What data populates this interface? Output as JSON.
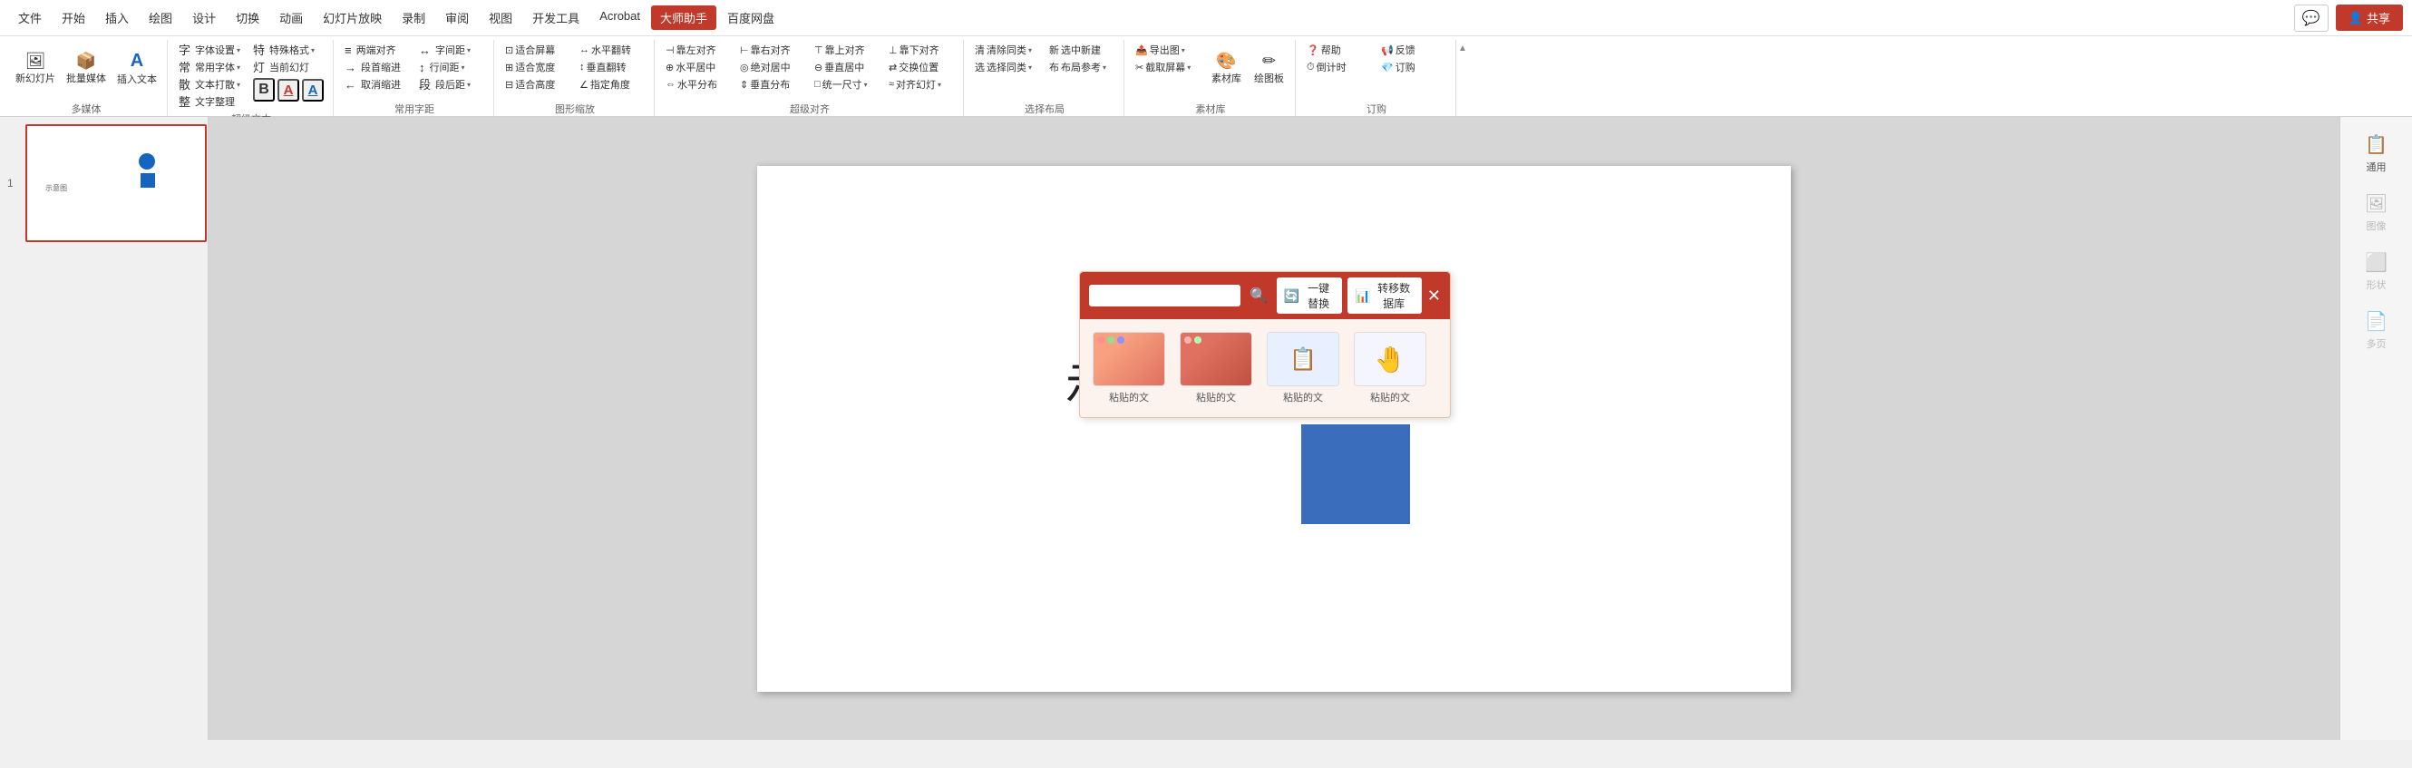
{
  "titlebar": {
    "menus": [
      "文件",
      "开始",
      "插入",
      "绘图",
      "设计",
      "切换",
      "动画",
      "幻灯片放映",
      "录制",
      "审阅",
      "视图",
      "开发工具",
      "Acrobat",
      "大师助手",
      "百度网盘"
    ],
    "active_menu": "大师助手",
    "chat_icon": "💬",
    "share_label": "共享"
  },
  "ribbon": {
    "groups": [
      {
        "label": "多媒体",
        "buttons": [
          {
            "id": "new-slide",
            "icon": "🖼",
            "label": "新幻灯片",
            "size": "large"
          },
          {
            "id": "batch-media",
            "icon": "📦",
            "label": "批量媒体",
            "size": "large"
          },
          {
            "id": "insert-text",
            "icon": "A",
            "label": "插入文本",
            "size": "large"
          }
        ]
      },
      {
        "label": "超级文本",
        "buttons": [
          {
            "id": "font-setting",
            "icon": "字",
            "label": "字体设置"
          },
          {
            "id": "common-font",
            "icon": "常",
            "label": "常用字体"
          },
          {
            "id": "text-scatter",
            "icon": "散",
            "label": "文本打散"
          },
          {
            "id": "text-arrange",
            "icon": "整",
            "label": "文字整理"
          },
          {
            "id": "special-format",
            "icon": "特",
            "label": "特殊格式"
          },
          {
            "id": "current-ppt",
            "icon": "灯",
            "label": "当前幻灯"
          },
          {
            "id": "bold-btn",
            "icon": "B",
            "label": ""
          },
          {
            "id": "color-red",
            "icon": "A",
            "label": ""
          },
          {
            "id": "color-blue",
            "icon": "A",
            "label": ""
          }
        ]
      },
      {
        "label": "常用字距",
        "buttons": [
          {
            "id": "justify",
            "icon": "≡",
            "label": "两端对齐"
          },
          {
            "id": "indent-increase",
            "icon": "→",
            "label": "段首缩进"
          },
          {
            "id": "indent-decrease",
            "icon": "←",
            "label": "取消缩进"
          },
          {
            "id": "spacing",
            "icon": "↕",
            "label": "字间距"
          },
          {
            "id": "line-spacing",
            "icon": "行",
            "label": "行间距"
          },
          {
            "id": "para-spacing",
            "icon": "段",
            "label": "段后距"
          }
        ]
      },
      {
        "label": "图形缩放",
        "buttons": [
          {
            "id": "fit-screen",
            "icon": "⊡",
            "label": "适合屏幕"
          },
          {
            "id": "fit-width",
            "icon": "⊞",
            "label": "适合宽度"
          },
          {
            "id": "fit-height",
            "icon": "⊟",
            "label": "适合高度"
          },
          {
            "id": "h-flip",
            "icon": "↔",
            "label": "水平翻转"
          },
          {
            "id": "v-flip",
            "icon": "↕",
            "label": "垂直翻转"
          },
          {
            "id": "angle",
            "icon": "∠",
            "label": "指定角度"
          }
        ]
      },
      {
        "label": "超级对齐",
        "buttons": [
          {
            "id": "align-left",
            "icon": "⊣",
            "label": "靠左对齐"
          },
          {
            "id": "align-right",
            "icon": "⊢",
            "label": "靠右对齐"
          },
          {
            "id": "align-top",
            "icon": "⊤",
            "label": "靠上对齐"
          },
          {
            "id": "align-bottom",
            "icon": "⊥",
            "label": "靠下对齐"
          },
          {
            "id": "h-center",
            "icon": "⊕",
            "label": "水平居中"
          },
          {
            "id": "abs-center",
            "icon": "◎",
            "label": "绝对居中"
          },
          {
            "id": "v-center",
            "icon": "⊖",
            "label": "垂直居中"
          },
          {
            "id": "h-distribute",
            "icon": "⇔",
            "label": "水平分布"
          },
          {
            "id": "v-distribute",
            "icon": "⇕",
            "label": "垂直分布"
          },
          {
            "id": "uniform-size",
            "icon": "□",
            "label": "统一尺寸"
          },
          {
            "id": "swap",
            "icon": "⇄",
            "label": "交换位置"
          },
          {
            "id": "ppt-align",
            "icon": "≈",
            "label": "对齐幻灯"
          }
        ]
      },
      {
        "label": "选择布局",
        "buttons": [
          {
            "id": "clear-same",
            "icon": "清",
            "label": "清除同类"
          },
          {
            "id": "select-same",
            "icon": "选",
            "label": "选择同类"
          },
          {
            "id": "new-select",
            "icon": "新",
            "label": "选中新建"
          },
          {
            "id": "layout-ref",
            "icon": "布",
            "label": "布局参考"
          }
        ]
      },
      {
        "label": "素材库",
        "buttons": [
          {
            "id": "export-fig",
            "icon": "📤",
            "label": "导出图▼"
          },
          {
            "id": "screenshot",
            "icon": "✂",
            "label": "截取屏幕"
          },
          {
            "id": "material-lib",
            "icon": "🎨",
            "label": "素材库"
          },
          {
            "id": "drawing-board",
            "icon": "✏",
            "label": "绘图板"
          }
        ]
      },
      {
        "label": "订购",
        "buttons": [
          {
            "id": "help",
            "icon": "❓",
            "label": "帮助"
          },
          {
            "id": "countdown",
            "icon": "⏱",
            "label": "倒计时"
          },
          {
            "id": "feedback",
            "icon": "📢",
            "label": "反馈"
          },
          {
            "id": "subscribe",
            "icon": "💎",
            "label": "订购"
          }
        ]
      }
    ]
  },
  "sidebar": {
    "items": [
      {
        "id": "general",
        "icon": "📋",
        "label": "通用",
        "disabled": false
      },
      {
        "id": "image",
        "icon": "🖼",
        "label": "图像",
        "disabled": true
      },
      {
        "id": "shape",
        "icon": "⬜",
        "label": "形状",
        "disabled": true
      },
      {
        "id": "multipage",
        "icon": "📄",
        "label": "多页",
        "disabled": true
      }
    ]
  },
  "canvas": {
    "text": "示意图",
    "slide_num": "1"
  },
  "floating_panel": {
    "search_placeholder": "",
    "replace_btn": "一键替换",
    "transfer_btn": "转移数据库",
    "paste_items": [
      {
        "label": "粘贴的文",
        "type": "red-gradient"
      },
      {
        "label": "粘贴的文",
        "type": "dark-red"
      },
      {
        "label": "粘贴的文",
        "type": "list"
      },
      {
        "label": "粘贴的文",
        "type": "hand"
      }
    ]
  },
  "icons": {
    "search": "🔍",
    "replace": "🔄",
    "transfer": "📊",
    "close": "✕",
    "bold": "B",
    "color_red": "A",
    "color_blue": "A",
    "dropdown": "▾",
    "chat": "💬",
    "share": "共享"
  }
}
